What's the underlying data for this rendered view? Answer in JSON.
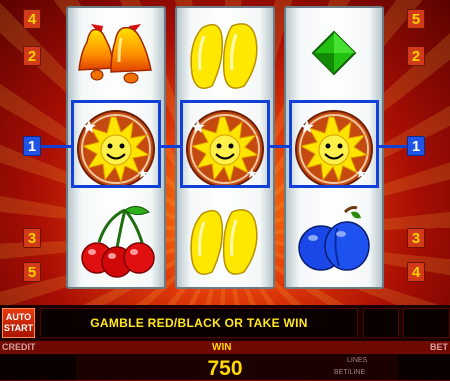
{
  "paytable_left": [
    "4",
    "2",
    "1",
    "3",
    "5"
  ],
  "paytable_right": [
    "5",
    "2",
    "1",
    "3",
    "4"
  ],
  "active_line": "1",
  "reels": [
    [
      "bell",
      "sun",
      "cherries"
    ],
    [
      "lemon",
      "sun",
      "lemon"
    ],
    [
      "diamond",
      "sun",
      "plum"
    ]
  ],
  "bottom": {
    "auto_start_line1": "AUTO",
    "auto_start_line2": "START",
    "message": "GAMBLE RED/BLACK OR TAKE WIN",
    "credit_label": "CREDIT",
    "win_label": "WIN",
    "bet_label": "BET",
    "lines_label": "LINES",
    "bet_line_label": "BET/LINE",
    "win_value": "750"
  },
  "colors": {
    "payline": "#1140d8",
    "accent": "#ffd800",
    "number_box": "#d23a18"
  }
}
